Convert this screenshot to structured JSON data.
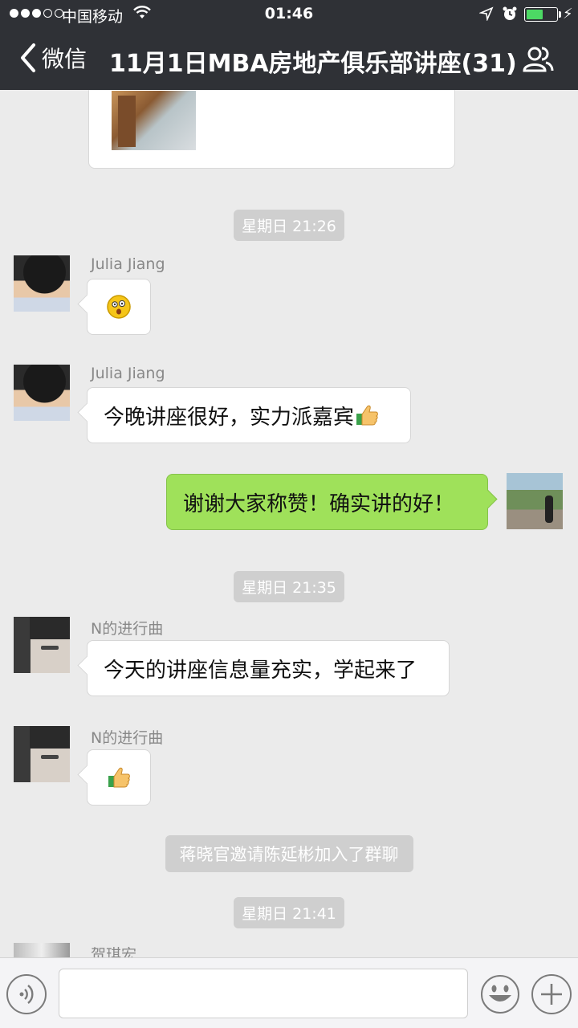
{
  "status": {
    "carrier": "中国移动",
    "time": "01:46",
    "battery_color": "#4cd964"
  },
  "nav": {
    "back_label": "微信",
    "title": "11月1日MBA房地产俱乐部讲座(31)",
    "icons": [
      "chevron-left-icon",
      "group-members-icon"
    ]
  },
  "chat": {
    "timestamps": [
      "星期日 21:26",
      "星期日 21:35",
      "星期日 21:41"
    ],
    "messages": [
      {
        "sender": "Julia Jiang",
        "text": "",
        "emoji": "shocked-face-emoji"
      },
      {
        "sender": "Julia Jiang",
        "text": "今晚讲座很好，实力派嘉宾",
        "emoji": "thumbs-up-emoji"
      },
      {
        "sender": "",
        "text": "谢谢大家称赞！确实讲的好！",
        "outgoing": true
      },
      {
        "sender": "N的进行曲",
        "text": "今天的讲座信息量充实，学起来了"
      },
      {
        "sender": "N的进行曲",
        "text": "",
        "emoji": "thumbs-up-emoji"
      },
      {
        "sender": "贺琪宏",
        "text": ""
      }
    ],
    "system_message": "蒋晓官邀请陈延彬加入了群聊",
    "colors": {
      "outgoing_bubble": "#9fe15a",
      "incoming_bubble": "#ffffff",
      "background": "#ebebeb"
    }
  },
  "input_bar": {
    "icons": [
      "voice-icon",
      "emoji-icon",
      "plus-icon"
    ],
    "text_value": ""
  }
}
